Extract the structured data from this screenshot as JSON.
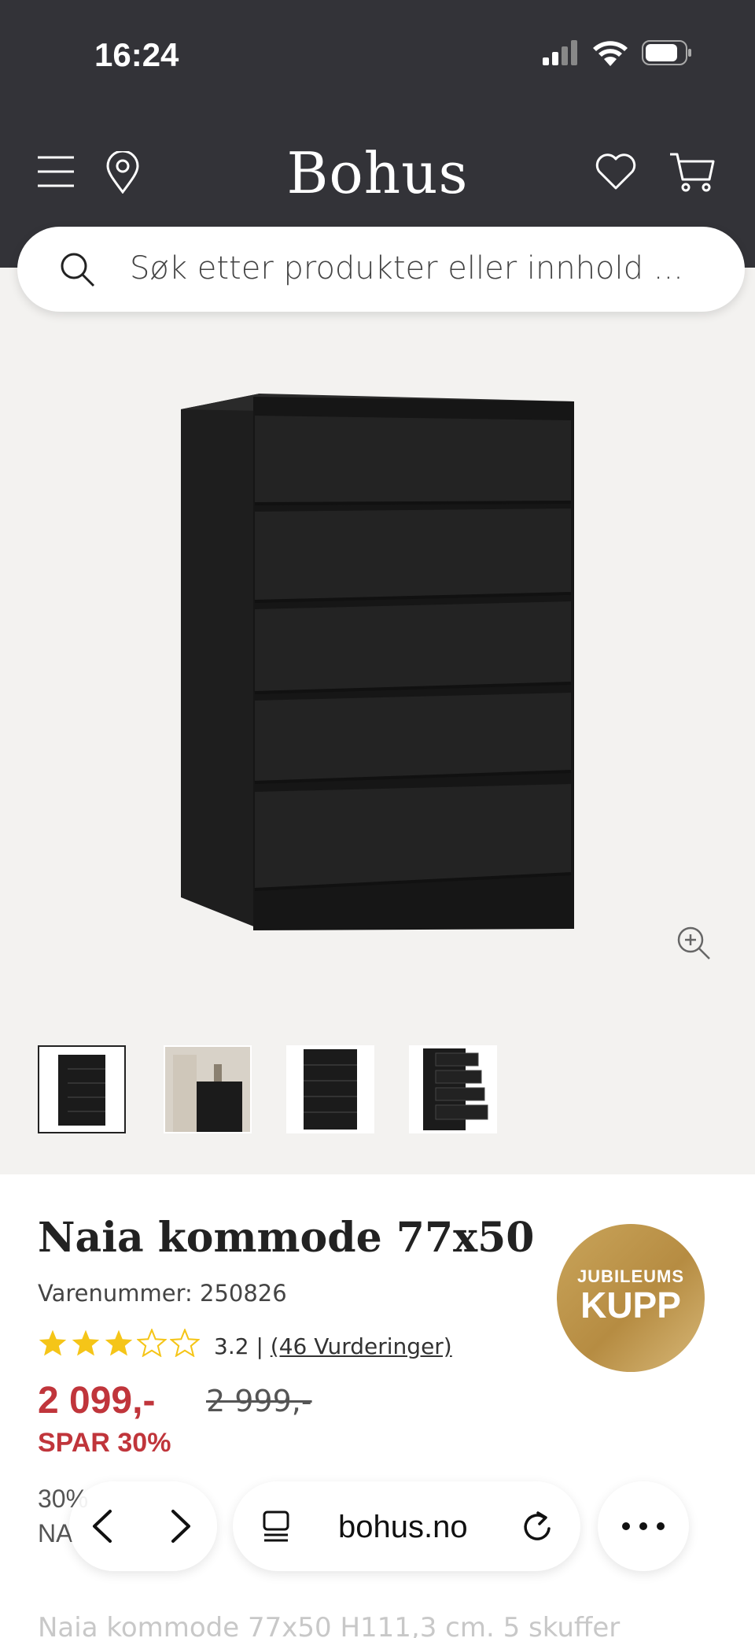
{
  "status_bar": {
    "time": "16:24"
  },
  "header": {
    "logo": "Bohus"
  },
  "search": {
    "placeholder": "Søk etter produkter eller innhold ..."
  },
  "product": {
    "title": "Naia kommode 77x50",
    "sku": "Varenummer: 250826",
    "rating_value": "3.2",
    "rating_separator": "|",
    "reviews": "(46 Vurderinger)",
    "stars_filled": 3,
    "stars_total": 5,
    "price": "2 099,-",
    "old_price": "2 999,-",
    "save": "SPAR 30%",
    "badge_line1": "JUBILEUMS",
    "badge_line2": "KUPP",
    "promo_line1": "30%",
    "promo_line2": "NA",
    "description": "Naia kommode 77x50 H111,3 cm. 5 skuffer"
  },
  "gallery": {
    "thumbnail_count": 4,
    "active_index": 0
  },
  "browser": {
    "url": "bohus.no"
  },
  "colors": {
    "header_bg": "#333338",
    "gallery_bg": "#f3f2f0",
    "price_red": "#c0353b",
    "star_yellow": "#f5c518",
    "badge_gold": "#c9a45a"
  }
}
